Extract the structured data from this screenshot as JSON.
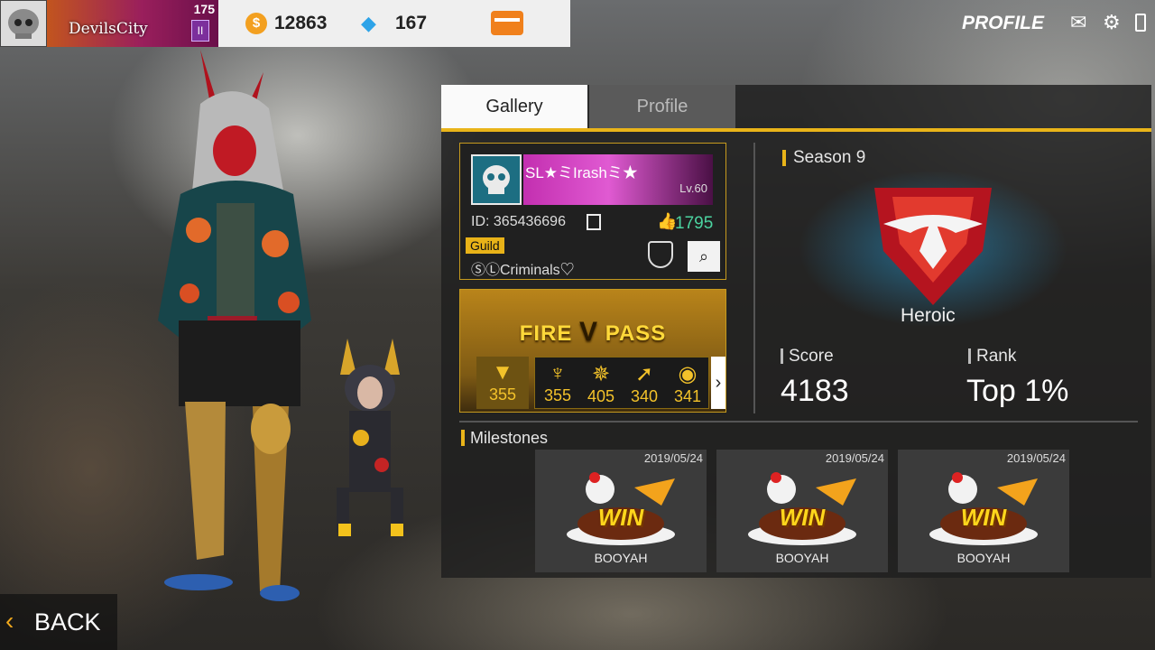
{
  "header": {
    "player_banner": {
      "name": "DevilsCity",
      "level": "175",
      "badge": "II"
    },
    "currency": {
      "coins": "12863",
      "diamonds": "167"
    },
    "screen_title": "PROFILE"
  },
  "tabs": {
    "gallery": "Gallery",
    "profile": "Profile"
  },
  "player": {
    "name": "SL★ミIrashミ★",
    "level": "Lv.60",
    "id": "ID: 365436696",
    "likes": "1795",
    "guild_label": "Guild",
    "guild_name": "ⓈⓁCriminals♡"
  },
  "fire_pass": {
    "title_left": "FIRE",
    "title_right": "PASS",
    "items": [
      {
        "icon": "fox-icon",
        "value": "355"
      },
      {
        "icon": "horn-icon",
        "value": "355"
      },
      {
        "icon": "beetle-icon",
        "value": "405"
      },
      {
        "icon": "rocket-icon",
        "value": "340"
      },
      {
        "icon": "disc-icon",
        "value": "341"
      }
    ]
  },
  "season": {
    "label": "Season 9",
    "rank_name": "Heroic",
    "score_label": "Score",
    "score": "4183",
    "rank_label": "Rank",
    "rank": "Top 1%"
  },
  "milestones": {
    "title": "Milestones",
    "cards": [
      {
        "date": "2019/05/24",
        "art_text": "WIN",
        "label": "BOOYAH"
      },
      {
        "date": "2019/05/24",
        "art_text": "WIN",
        "label": "BOOYAH"
      },
      {
        "date": "2019/05/24",
        "art_text": "WIN",
        "label": "BOOYAH"
      }
    ]
  },
  "footer": {
    "back": "BACK"
  },
  "colors": {
    "accent": "#e9b419",
    "likes": "#4bd3a0",
    "coin": "#f3a020",
    "diamond": "#2da3e8"
  }
}
